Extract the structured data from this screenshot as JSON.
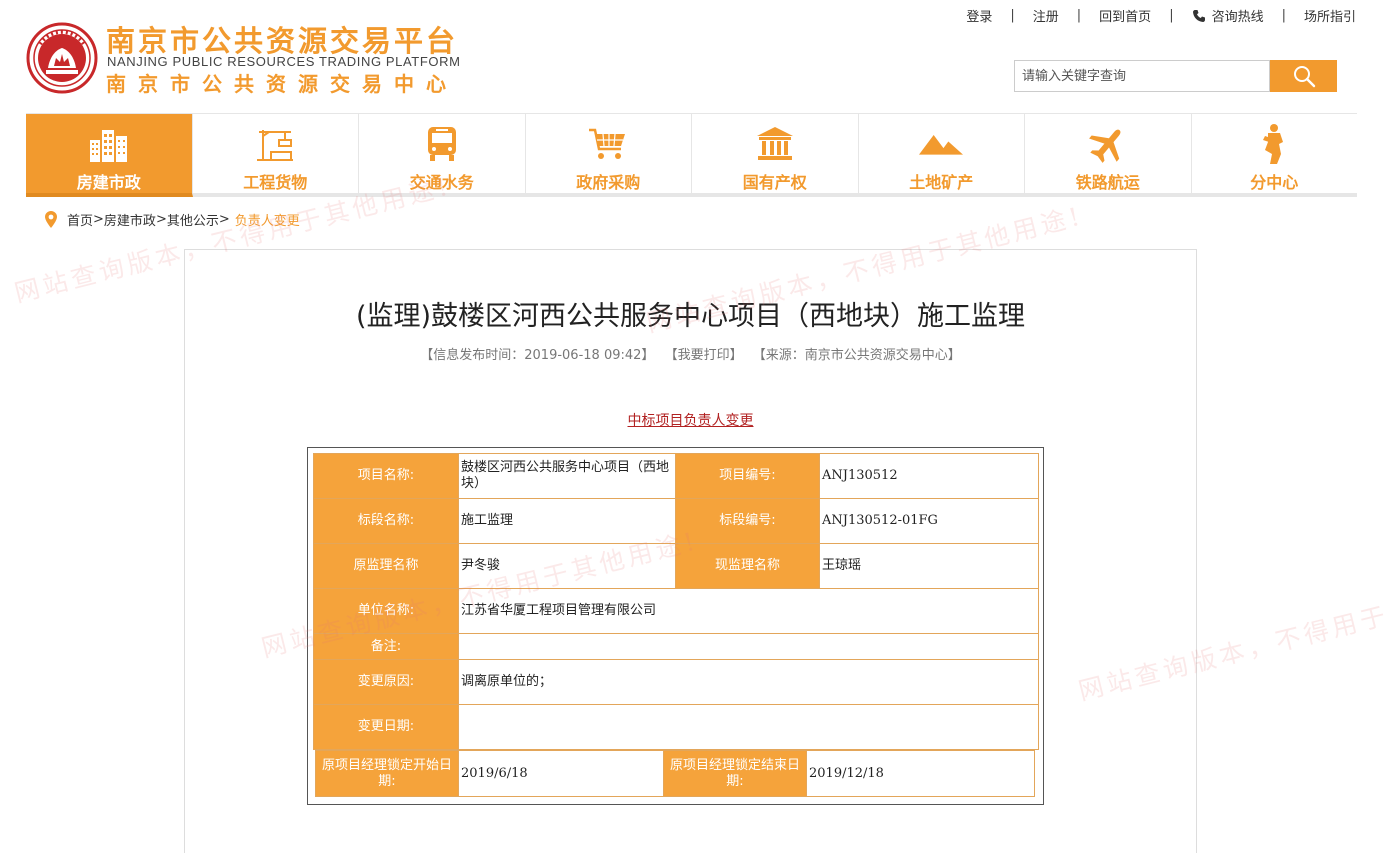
{
  "brand": {
    "name_cn": "南京市公共资源交易平台",
    "name_en": "NANJING PUBLIC RESOURCES TRADING PLATFORM",
    "sub_cn": "南京市公共资源交易中心"
  },
  "toplinks": {
    "login": "登录",
    "register": "注册",
    "home": "回到首页",
    "hotline": "咨询热线",
    "guide": "场所指引",
    "separator": "|"
  },
  "search": {
    "placeholder": "请输入关键字查询"
  },
  "nav": {
    "items": [
      {
        "label": "房建市政",
        "icon": "buildings-icon",
        "active": true
      },
      {
        "label": "工程货物",
        "icon": "crane-icon"
      },
      {
        "label": "交通水务",
        "icon": "bus-icon"
      },
      {
        "label": "政府采购",
        "icon": "cart-icon"
      },
      {
        "label": "国有产权",
        "icon": "bank-icon"
      },
      {
        "label": "土地矿产",
        "icon": "mountain-icon"
      },
      {
        "label": "铁路航运",
        "icon": "airplane-icon"
      },
      {
        "label": "分中心",
        "icon": "figure-icon"
      }
    ]
  },
  "breadcrumb": {
    "home": "首页",
    "level1": "房建市政",
    "level2": "其他公示",
    "current": "负责人变更",
    "sep": ">"
  },
  "article": {
    "title": "(监理)鼓楼区河西公共服务中心项目（西地块）施工监理",
    "publish_time": "【信息发布时间：2019-06-18 09:42】",
    "print": "【我要打印】",
    "source": "【来源：南京市公共资源交易中心】",
    "notice_link": "中标项目负责人变更"
  },
  "table": {
    "project_name_label": "项目名称:",
    "project_name": "鼓楼区河西公共服务中心项目（西地块）",
    "project_no_label": "项目编号:",
    "project_no": "ANJ130512",
    "section_name_label": "标段名称:",
    "section_name": "施工监理",
    "section_no_label": "标段编号:",
    "section_no": "ANJ130512-01FG",
    "old_supervisor_label": "原监理名称",
    "old_supervisor": "尹冬骏",
    "new_supervisor_label": "现监理名称",
    "new_supervisor": "王琼瑶",
    "company_label": "单位名称:",
    "company": "江苏省华厦工程项目管理有限公司",
    "remark_label": "备注:",
    "remark": "",
    "reason_label": "变更原因:",
    "reason": "调离原单位的；",
    "change_date_label": "变更日期:",
    "change_date": "",
    "lock_start_label": "原项目经理锁定开始日期:",
    "lock_start": "2019/6/18",
    "lock_end_label": "原项目经理锁定结束日期:",
    "lock_end": "2019/12/18"
  },
  "watermark": "网站查询版本，不得用于其他用途!",
  "colors": {
    "accent": "#f29a2e",
    "link_red": "#b22222"
  }
}
